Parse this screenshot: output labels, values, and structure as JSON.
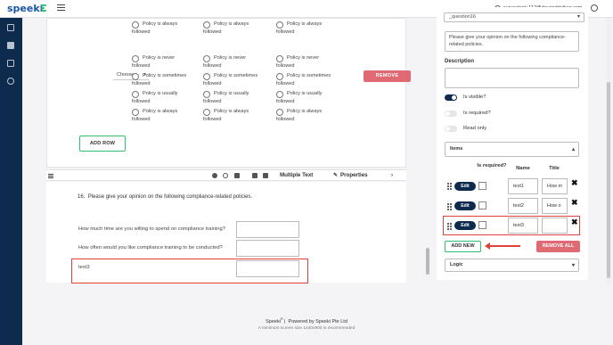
{
  "app": {
    "logo_text": "speeki",
    "user_email": "surveytest+112@devanddeliver.com"
  },
  "sidebar": {
    "items": [
      {
        "icon": "dashboard-icon"
      },
      {
        "icon": "survey-icon"
      },
      {
        "icon": "edit-icon"
      },
      {
        "icon": "search-icon"
      }
    ]
  },
  "matrix": {
    "choose_label": "Choose...",
    "remove_label": "REMOVE",
    "add_row_label": "ADD ROW",
    "options": {
      "always": "Policy is always followed",
      "never": "Policy is never followed",
      "sometimes": "Policy is sometimes followed",
      "usually": "Policy is usually followed"
    }
  },
  "toolbar": {
    "type_label": "Multiple Text",
    "properties_label": "Properties"
  },
  "question": {
    "number": "16.",
    "title": "Please give your opinion on the following compliance-related policies.",
    "rows": [
      "How much time are you willing to spend on compliance training?",
      "How often would you like compliance training to be conducted?",
      "text3"
    ]
  },
  "panel": {
    "name_value": "_question16",
    "title_value": "Please give your opinion on the following compliance-related policies.",
    "description_label": "Description",
    "toggles": [
      {
        "label": "Is visible?",
        "on": true
      },
      {
        "label": "Is required?",
        "on": false
      },
      {
        "label": "Read only",
        "on": false
      }
    ],
    "items_label": "Items",
    "columns": {
      "required": "Is required?",
      "name": "Name",
      "title": "Title"
    },
    "rows": [
      {
        "edit": "Edit",
        "name": "text1",
        "title": "How m"
      },
      {
        "edit": "Edit",
        "name": "text2",
        "title": "How o"
      },
      {
        "edit": "Edit",
        "name": "text3",
        "title": ""
      }
    ],
    "add_new_label": "ADD NEW",
    "remove_all_label": "REMOVE ALL",
    "logic_label": "Logic"
  },
  "footer": {
    "brand": "Speeki",
    "trademark": "®",
    "powered": "Powered by Speeki Pte Ltd",
    "note": "A minimum screen size 1440x900 is recommended"
  },
  "colors": {
    "navy": "#0e2a4d",
    "green": "#2fbf71",
    "red": "#e06a73",
    "highlight": "#e0413f"
  }
}
